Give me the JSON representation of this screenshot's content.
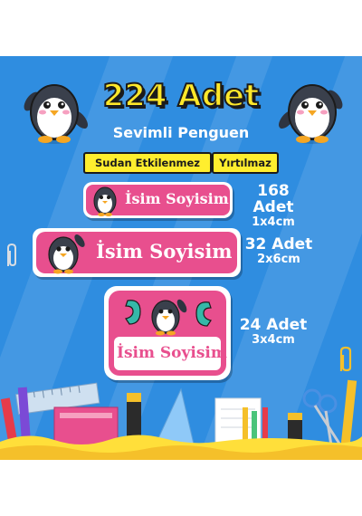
{
  "hero": {
    "title": "224 Adet",
    "subtitle": "Sevimli Penguen"
  },
  "badges": {
    "waterproof": "Sudan Etkilenmez",
    "tearproof": "Yırtılmaz"
  },
  "labels": [
    {
      "name": "İsim Soyisim",
      "count": "168 Adet",
      "size": "1x4cm"
    },
    {
      "name": "İsim Soyisim",
      "count": "32 Adet",
      "size": "2x6cm"
    },
    {
      "name": "İsim Soyisim",
      "count": "24 Adet",
      "size": "3x4cm"
    }
  ],
  "colors": {
    "background": "#2f8de0",
    "label_pink": "#e84f8e",
    "title_yellow": "#ffe82a"
  }
}
